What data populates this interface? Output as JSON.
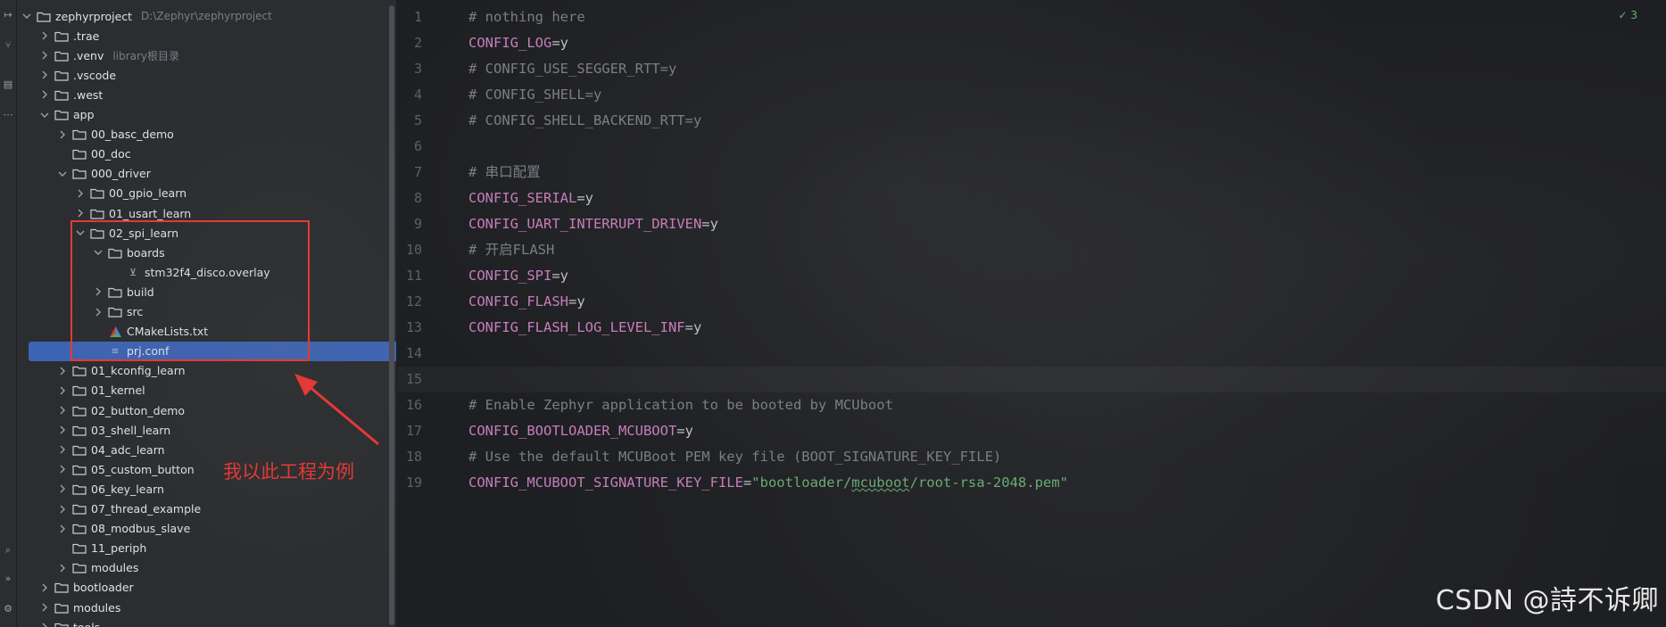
{
  "tree": {
    "items": [
      {
        "label": "zephyrproject",
        "hint": "D:\\Zephyr\\zephyrproject",
        "kind": "folder",
        "expanded": true,
        "depth": 0
      },
      {
        "label": ".trae",
        "kind": "folder",
        "expanded": false,
        "depth": 1
      },
      {
        "label": ".venv",
        "hint": "library根目录",
        "kind": "folder",
        "expanded": false,
        "depth": 1
      },
      {
        "label": ".vscode",
        "kind": "folder",
        "expanded": false,
        "depth": 1
      },
      {
        "label": ".west",
        "kind": "folder",
        "expanded": false,
        "depth": 1
      },
      {
        "label": "app",
        "kind": "folder",
        "expanded": true,
        "depth": 1
      },
      {
        "label": "00_basc_demo",
        "kind": "folder",
        "expanded": false,
        "depth": 2
      },
      {
        "label": "00_doc",
        "kind": "folder",
        "expanded": null,
        "depth": 2
      },
      {
        "label": "000_driver",
        "kind": "folder",
        "expanded": true,
        "depth": 2
      },
      {
        "label": "00_gpio_learn",
        "kind": "folder",
        "expanded": false,
        "depth": 3
      },
      {
        "label": "01_usart_learn",
        "kind": "folder",
        "expanded": false,
        "depth": 3
      },
      {
        "label": "02_spi_learn",
        "kind": "folder",
        "expanded": true,
        "depth": 3
      },
      {
        "label": "boards",
        "kind": "folder",
        "expanded": true,
        "depth": 4
      },
      {
        "label": "stm32f4_disco.overlay",
        "kind": "overlay",
        "expanded": null,
        "depth": 5
      },
      {
        "label": "build",
        "kind": "folder",
        "expanded": false,
        "depth": 4
      },
      {
        "label": "src",
        "kind": "folder",
        "expanded": false,
        "depth": 4
      },
      {
        "label": "CMakeLists.txt",
        "kind": "cmake",
        "expanded": null,
        "depth": 4
      },
      {
        "label": "prj.conf",
        "kind": "conf",
        "expanded": null,
        "depth": 4,
        "selected": true
      },
      {
        "label": "01_kconfig_learn",
        "kind": "folder",
        "expanded": false,
        "depth": 2
      },
      {
        "label": "01_kernel",
        "kind": "folder",
        "expanded": false,
        "depth": 2
      },
      {
        "label": "02_button_demo",
        "kind": "folder",
        "expanded": false,
        "depth": 2
      },
      {
        "label": "03_shell_learn",
        "kind": "folder",
        "expanded": false,
        "depth": 2
      },
      {
        "label": "04_adc_learn",
        "kind": "folder",
        "expanded": false,
        "depth": 2
      },
      {
        "label": "05_custom_button",
        "kind": "folder",
        "expanded": false,
        "depth": 2
      },
      {
        "label": "06_key_learn",
        "kind": "folder",
        "expanded": false,
        "depth": 2
      },
      {
        "label": "07_thread_example",
        "kind": "folder",
        "expanded": false,
        "depth": 2
      },
      {
        "label": "08_modbus_slave",
        "kind": "folder",
        "expanded": false,
        "depth": 2
      },
      {
        "label": "11_periph",
        "kind": "folder",
        "expanded": null,
        "depth": 2
      },
      {
        "label": "modules",
        "kind": "folder",
        "expanded": false,
        "depth": 2
      },
      {
        "label": "bootloader",
        "kind": "folder",
        "expanded": false,
        "depth": 1
      },
      {
        "label": "modules",
        "kind": "folder",
        "expanded": false,
        "depth": 1
      },
      {
        "label": "tools",
        "kind": "folder",
        "expanded": false,
        "depth": 1
      }
    ]
  },
  "annotation": {
    "text": "我以此工程为例",
    "color": "#e53935"
  },
  "editor": {
    "problems_count": "3",
    "current_line": 15,
    "lines": [
      {
        "n": "1",
        "parts": [
          {
            "t": "# nothing here",
            "c": "comment"
          }
        ]
      },
      {
        "n": "2",
        "parts": [
          {
            "t": "CONFIG_LOG",
            "c": "key"
          },
          {
            "t": "=y",
            "c": "eq"
          }
        ]
      },
      {
        "n": "3",
        "parts": [
          {
            "t": "# CONFIG_USE_SEGGER_RTT=y",
            "c": "comment"
          }
        ]
      },
      {
        "n": "4",
        "parts": [
          {
            "t": "# CONFIG_SHELL=y",
            "c": "comment"
          }
        ]
      },
      {
        "n": "5",
        "parts": [
          {
            "t": "# CONFIG_SHELL_BACKEND_RTT=y",
            "c": "comment"
          }
        ]
      },
      {
        "n": "6",
        "parts": []
      },
      {
        "n": "7",
        "parts": [
          {
            "t": "# 串口配置",
            "c": "comment"
          }
        ]
      },
      {
        "n": "8",
        "parts": [
          {
            "t": "CONFIG_SERIAL",
            "c": "key"
          },
          {
            "t": "=y",
            "c": "eq"
          }
        ]
      },
      {
        "n": "9",
        "parts": [
          {
            "t": "CONFIG_UART_INTERRUPT_DRIVEN",
            "c": "key"
          },
          {
            "t": "=y",
            "c": "eq"
          }
        ]
      },
      {
        "n": "10",
        "parts": [
          {
            "t": "# 开启FLASH",
            "c": "comment"
          }
        ]
      },
      {
        "n": "11",
        "parts": [
          {
            "t": "CONFIG_SPI",
            "c": "key"
          },
          {
            "t": "=y",
            "c": "eq"
          }
        ]
      },
      {
        "n": "12",
        "parts": [
          {
            "t": "CONFIG_FLASH",
            "c": "key"
          },
          {
            "t": "=y",
            "c": "eq"
          }
        ]
      },
      {
        "n": "13",
        "parts": [
          {
            "t": "CONFIG_FLASH_LOG_LEVEL_INF",
            "c": "key"
          },
          {
            "t": "=y",
            "c": "eq"
          }
        ]
      },
      {
        "n": "14",
        "parts": []
      },
      {
        "n": "15",
        "parts": []
      },
      {
        "n": "16",
        "parts": [
          {
            "t": "# Enable Zephyr application to be booted by MCUboot",
            "c": "comment"
          }
        ]
      },
      {
        "n": "17",
        "parts": [
          {
            "t": "CONFIG_BOOTLOADER_MCUBOOT",
            "c": "key"
          },
          {
            "t": "=y",
            "c": "eq"
          }
        ]
      },
      {
        "n": "18",
        "parts": [
          {
            "t": "# Use the default MCUBoot PEM key file (BOOT_SIGNATURE_KEY_FILE)",
            "c": "comment"
          }
        ]
      },
      {
        "n": "19",
        "parts": [
          {
            "t": "CONFIG_MCUBOOT_SIGNATURE_KEY_FILE",
            "c": "key"
          },
          {
            "t": "=",
            "c": "eq"
          },
          {
            "t": "\"bootloader/",
            "c": "str"
          },
          {
            "t": "mcuboot",
            "c": "strpart"
          },
          {
            "t": "/root-rsa-2048.pem\"",
            "c": "str"
          }
        ]
      }
    ]
  },
  "watermark": "CSDN @詩不诉卿"
}
